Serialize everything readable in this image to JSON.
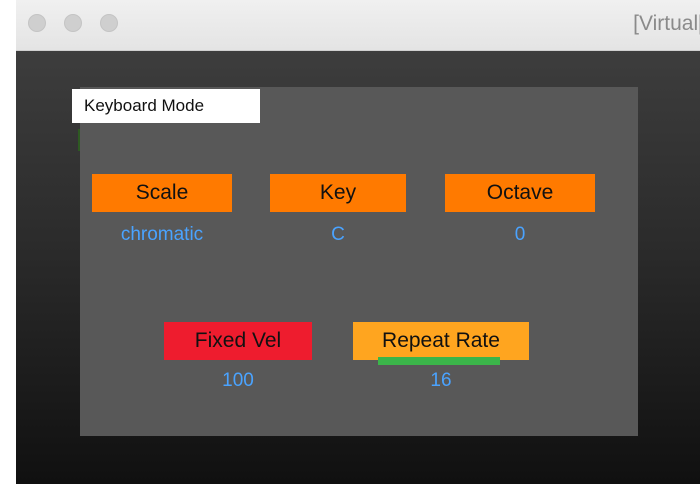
{
  "window": {
    "title": "[Virtual["
  },
  "panel": {
    "mode_label": "Keyboard Mode",
    "controls": {
      "scale": {
        "label": "Scale",
        "value": "chromatic"
      },
      "key": {
        "label": "Key",
        "value": "C"
      },
      "octave": {
        "label": "Octave",
        "value": "0"
      },
      "fixed_vel": {
        "label": "Fixed Vel",
        "value": "100"
      },
      "repeat_rate": {
        "label": "Repeat Rate",
        "value": "16"
      }
    }
  },
  "colors": {
    "header_orange": "#ff7a00",
    "fixed_vel_red": "#ee1c2e",
    "repeat_rate_amber": "#ffa51f",
    "value_blue": "#4aa3ff",
    "slider_green": "#3bb54a",
    "panel_gray": "#585858"
  }
}
